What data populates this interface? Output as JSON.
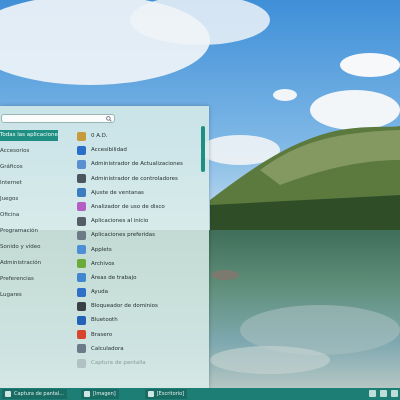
{
  "search": {
    "value": "",
    "placeholder": ""
  },
  "categories": [
    {
      "label": "Todas las aplicaciones",
      "active": true
    },
    {
      "label": "Accesorios"
    },
    {
      "label": "Gráficos"
    },
    {
      "label": "Internet"
    },
    {
      "label": "Juegos"
    },
    {
      "label": "Oficina"
    },
    {
      "label": "Programación"
    },
    {
      "label": "Sonido y vídeo"
    },
    {
      "label": "Administración"
    },
    {
      "label": "Preferencias"
    },
    {
      "label": "Lugares"
    }
  ],
  "apps": [
    {
      "label": "0 A.D.",
      "icon": "0ad-icon",
      "color": "#c79a3c"
    },
    {
      "label": "Accesibilidad",
      "icon": "accessibility-icon",
      "color": "#2a6fc7"
    },
    {
      "label": "Administrador de Actualizaciones",
      "icon": "update-manager-icon",
      "color": "#5a8fd0"
    },
    {
      "label": "Administrador de controladores",
      "icon": "driver-manager-icon",
      "color": "#4a5560"
    },
    {
      "label": "Ajuste de ventanas",
      "icon": "window-tiling-icon",
      "color": "#3c7dbf"
    },
    {
      "label": "Analizador de uso de disco",
      "icon": "disk-usage-icon",
      "color": "#b45ec4"
    },
    {
      "label": "Aplicaciones al inicio",
      "icon": "startup-apps-icon",
      "color": "#555e66"
    },
    {
      "label": "Aplicaciones preferidas",
      "icon": "preferred-apps-icon",
      "color": "#6c7a86"
    },
    {
      "label": "Applets",
      "icon": "applets-icon",
      "color": "#4c8fd6"
    },
    {
      "label": "Archivos",
      "icon": "files-icon",
      "color": "#6bab3a"
    },
    {
      "label": "Áreas de trabajo",
      "icon": "workspaces-icon",
      "color": "#3f87cf"
    },
    {
      "label": "Ayuda",
      "icon": "help-icon",
      "color": "#2f6fc9"
    },
    {
      "label": "Bloqueador de dominios",
      "icon": "domain-blocker-icon",
      "color": "#3a3f46"
    },
    {
      "label": "Bluetooth",
      "icon": "bluetooth-icon",
      "color": "#2462b8"
    },
    {
      "label": "Brasero",
      "icon": "brasero-icon",
      "color": "#d8452f"
    },
    {
      "label": "Calculadora",
      "icon": "calculator-icon",
      "color": "#6b7b88"
    },
    {
      "label": "Captura de pantalla",
      "icon": "screenshot-icon",
      "color": "#8c979e",
      "faded": true
    }
  ],
  "taskbar": {
    "items": [
      {
        "label": "Captura de pantal..."
      },
      {
        "label": "[Imagen]"
      },
      {
        "label": "[Escritorio]"
      }
    ]
  }
}
